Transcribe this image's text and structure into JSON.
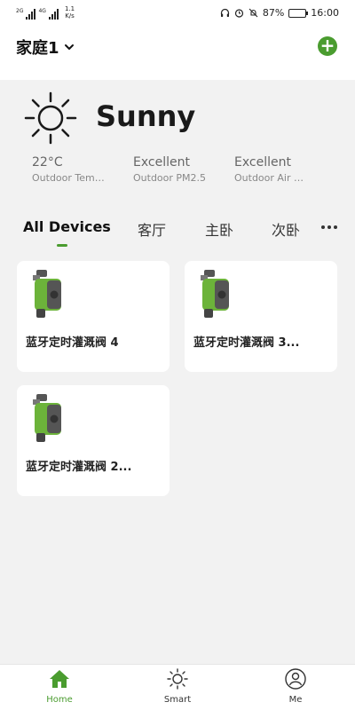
{
  "status_bar": {
    "net1": "2G",
    "net2": "4G",
    "speed_value": "1.1",
    "speed_unit": "K/s",
    "battery": "87%",
    "battery_level": 0.87,
    "time": "16:00"
  },
  "header": {
    "home_name": "家庭1",
    "add_icon": "plus-circle-icon"
  },
  "weather": {
    "condition": "Sunny",
    "icon": "sun-icon",
    "stats": [
      {
        "value": "22°C",
        "label": "Outdoor Temperature"
      },
      {
        "value": "Excellent",
        "label": "Outdoor PM2.5"
      },
      {
        "value": "Excellent",
        "label": "Outdoor Air Quality"
      }
    ]
  },
  "tabs": [
    {
      "label": "All Devices",
      "active": true
    },
    {
      "label": "客厅",
      "active": false
    },
    {
      "label": "主卧",
      "active": false
    },
    {
      "label": "次卧",
      "active": false
    }
  ],
  "devices": [
    {
      "name": "蓝牙定时灌溉阀 4"
    },
    {
      "name": "蓝牙定时灌溉阀 3..."
    },
    {
      "name": "蓝牙定时灌溉阀 2..."
    }
  ],
  "bottom_nav": [
    {
      "label": "Home",
      "icon": "home-icon",
      "active": true
    },
    {
      "label": "Smart",
      "icon": "sun-icon",
      "active": false
    },
    {
      "label": "Me",
      "icon": "user-icon",
      "active": false
    }
  ],
  "colors": {
    "accent": "#4a9c2f",
    "background": "#f2f2f2",
    "card": "#ffffff"
  }
}
